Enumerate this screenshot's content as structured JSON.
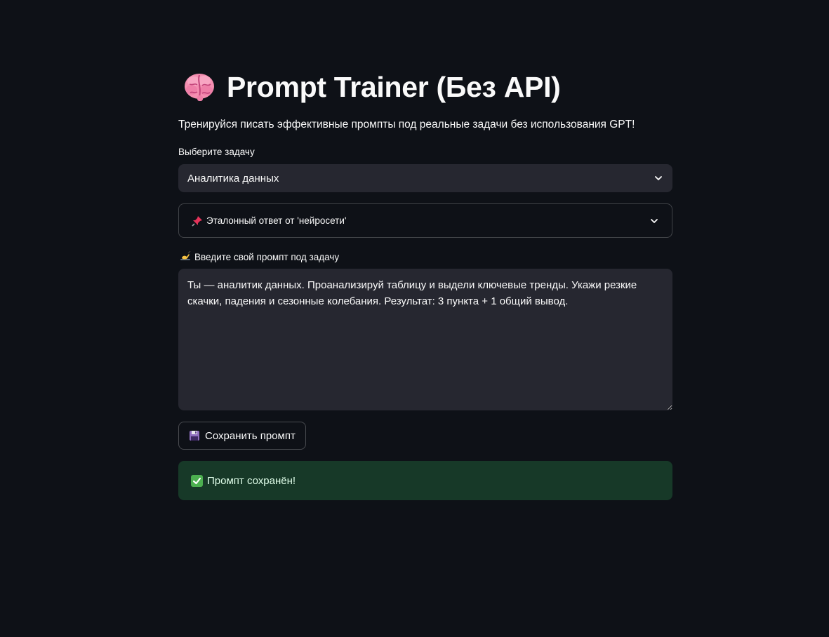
{
  "header": {
    "title": "Prompt Trainer (Без API)",
    "title_icon": "brain-icon",
    "subtitle": "Тренируйся писать эффективные промпты под реальные задачи без использования GPT!"
  },
  "task_select": {
    "label": "Выберите задачу",
    "selected_value": "Аналитика данных"
  },
  "reference_expander": {
    "icon": "pushpin-icon",
    "label": "Эталонный ответ от 'нейросети'"
  },
  "prompt_input": {
    "icon": "writing-hand-icon",
    "label": "Введите свой промпт под задачу",
    "value": "Ты — аналитик данных. Проанализируй таблицу и выдели ключевые тренды. Укажи резкие скачки, падения и сезонные колебания. Результат: 3 пункта + 1 общий вывод."
  },
  "save_button": {
    "icon": "floppy-disk-icon",
    "label": "Сохранить промпт"
  },
  "success_alert": {
    "icon": "check-mark-icon",
    "message": "Промпт сохранён!"
  },
  "colors": {
    "background": "#0e1117",
    "input_background": "#262730",
    "success_background": "#173928",
    "text": "#fafafa"
  }
}
